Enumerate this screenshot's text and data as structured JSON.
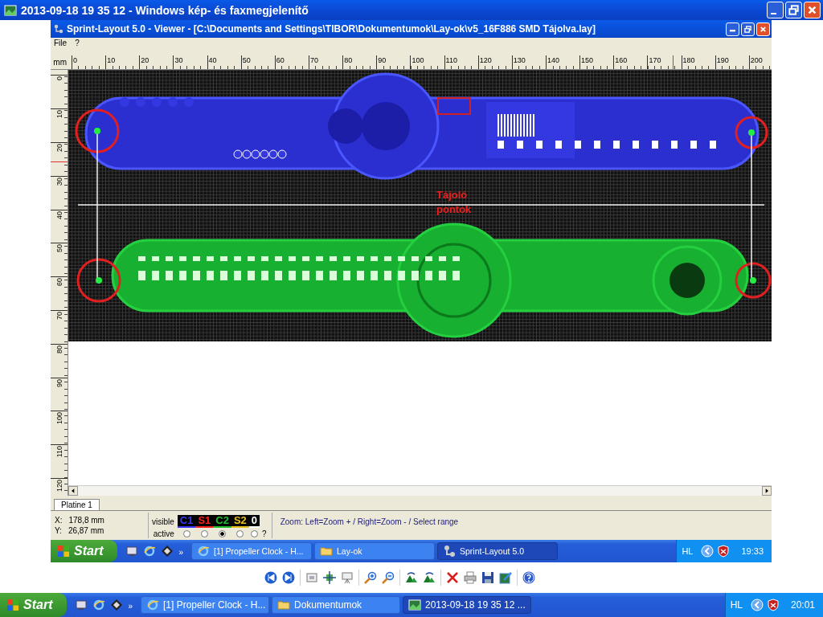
{
  "viewer": {
    "title": "2013-09-18 19 35 12 - Windows kép- és faxmegjelenítő"
  },
  "screenshot": {
    "window": {
      "title": "Sprint-Layout 5.0 - Viewer - [C:\\Documents and Settings\\TIBOR\\Dokumentumok\\Lay-ok\\v5_16F886 SMD Tájolva.lay]"
    },
    "menu": [
      "File",
      "?"
    ],
    "ruler_unit": "mm",
    "top_ruler": [
      "0",
      "10",
      "20",
      "30",
      "40",
      "50",
      "60",
      "70",
      "80",
      "90",
      "100",
      "110",
      "120",
      "130",
      "140",
      "150",
      "160",
      "170",
      "180",
      "190",
      "200"
    ],
    "left_ruler": [
      "0",
      "10",
      "20",
      "30",
      "40",
      "50",
      "60",
      "70",
      "80",
      "90",
      "100",
      "110",
      "120"
    ],
    "canvas": {
      "annotation": "Tájoló pontok"
    },
    "tabs": [
      {
        "label": "Platine 1",
        "selected": true
      }
    ],
    "status": {
      "x_label": "X:",
      "x": "178,8 mm",
      "y_label": "Y:",
      "y": "26,87 mm",
      "visible_label": "visible",
      "active_label": "active",
      "help": "?",
      "message": "Zoom: Left=Zoom + / Right=Zoom - / Select range",
      "layers": [
        {
          "label": "C1",
          "color": "#3838ff",
          "selected": false
        },
        {
          "label": "S1",
          "color": "#ff2020",
          "selected": false
        },
        {
          "label": "C2",
          "color": "#20c030",
          "selected": true
        },
        {
          "label": "S2",
          "color": "#e8c020",
          "selected": false
        },
        {
          "label": "0",
          "color": "#ffffff",
          "selected": false
        }
      ]
    },
    "taskbar": {
      "start": "Start",
      "more": "»",
      "tasks": [
        {
          "label": "[1] Propeller Clock - H...",
          "kind": "browser",
          "selected": false
        },
        {
          "label": "Lay-ok",
          "kind": "folder",
          "selected": false
        },
        {
          "label": "Sprint-Layout 5.0",
          "kind": "app",
          "selected": true
        }
      ],
      "language": "HL",
      "time": "19:33"
    }
  },
  "taskbar": {
    "start": "Start",
    "more": "»",
    "tasks": [
      {
        "label": "[1] Propeller Clock - H...",
        "kind": "browser",
        "selected": false
      },
      {
        "label": "Dokumentumok",
        "kind": "folder",
        "selected": false
      },
      {
        "label": "2013-09-18 19 35 12 ...",
        "kind": "image",
        "selected": true
      }
    ],
    "language": "HL",
    "time": "20:01"
  }
}
